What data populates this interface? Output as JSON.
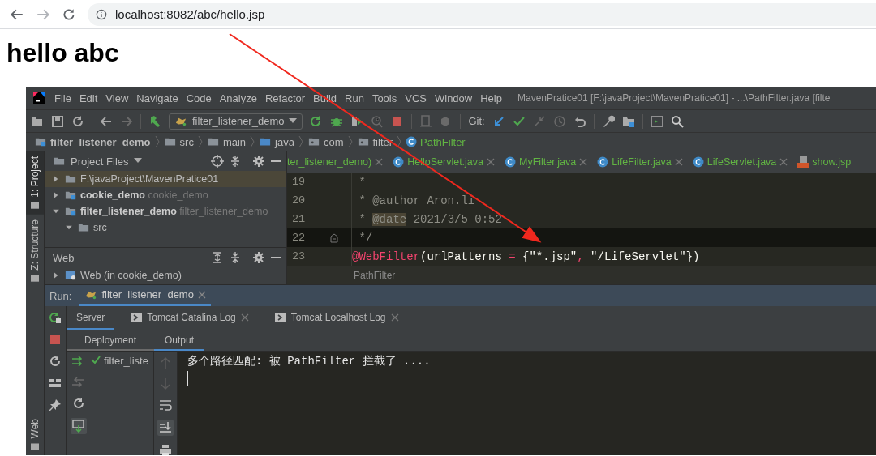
{
  "browser": {
    "address": "localhost:8082/abc/hello.jsp"
  },
  "page": {
    "heading": "hello abc"
  },
  "ide": {
    "menu": [
      "File",
      "Edit",
      "View",
      "Navigate",
      "Code",
      "Analyze",
      "Refactor",
      "Build",
      "Run",
      "Tools",
      "VCS",
      "Window",
      "Help"
    ],
    "title": "MavenPratice01 [F:\\javaProject\\MavenPratice01] - ...\\PathFilter.java [filte",
    "run_config": "filter_listener_demo",
    "git_label": "Git:",
    "breadcrumb": [
      {
        "label": "filter_listener_demo",
        "kind": "module"
      },
      {
        "label": "src",
        "kind": "folder"
      },
      {
        "label": "main",
        "kind": "folder"
      },
      {
        "label": "java",
        "kind": "source"
      },
      {
        "label": "com",
        "kind": "package"
      },
      {
        "label": "filter",
        "kind": "package"
      },
      {
        "label": "PathFilter",
        "kind": "class"
      }
    ],
    "left_stripe": [
      {
        "label": "1: Project",
        "selected": true
      },
      {
        "label": "Z: Structure",
        "selected": false
      }
    ],
    "bottom_stripe": [
      {
        "label": "Web",
        "selected": false
      }
    ],
    "project": {
      "title": "Project Files",
      "tree": [
        {
          "label": "F:\\javaProject\\MavenPratice01",
          "kind": "folder",
          "expanded": false,
          "selected": true
        },
        {
          "label": "cookie_demo",
          "hint": "cookie_demo",
          "kind": "module",
          "expanded": false,
          "selected": false
        },
        {
          "label": "filter_listener_demo",
          "hint": "filter_listener_demo",
          "kind": "module",
          "expanded": true,
          "selected": false,
          "children": [
            {
              "label": "src",
              "kind": "folder",
              "expanded": true,
              "selected": false
            }
          ]
        }
      ]
    },
    "web": {
      "title": "Web",
      "tree": [
        {
          "label": "Web (in cookie_demo)",
          "kind": "web",
          "expanded": false,
          "selected": false
        }
      ]
    },
    "editor_tabs": [
      {
        "label": "ter_listener_demo)",
        "kind": "none"
      },
      {
        "label": "HelloServlet.java",
        "kind": "class"
      },
      {
        "label": "MyFilter.java",
        "kind": "class"
      },
      {
        "label": "LifeFilter.java",
        "kind": "class"
      },
      {
        "label": "LifeServlet.java",
        "kind": "class"
      },
      {
        "label": "show.jsp",
        "kind": "jsp"
      }
    ],
    "code": [
      {
        "number": "19",
        "current": false,
        "tokens": [
          {
            "kind": "comment",
            "text": " *"
          }
        ]
      },
      {
        "number": "20",
        "current": false,
        "tokens": [
          {
            "kind": "comment",
            "text": " * @author Aron.li"
          }
        ]
      },
      {
        "number": "21",
        "current": false,
        "tokens": [
          {
            "kind": "comment",
            "text": " * "
          },
          {
            "kind": "doc_tag",
            "text": "@date"
          },
          {
            "kind": "comment",
            "text": " 2021/3/5 0:52"
          }
        ]
      },
      {
        "number": "22",
        "current": true,
        "tokens": [
          {
            "kind": "comment",
            "text": " */"
          }
        ]
      },
      {
        "number": "23",
        "current": false,
        "tokens": [
          {
            "kind": "annotation",
            "text": "@WebFilter"
          },
          {
            "kind": "plain",
            "text": "(urlPatterns "
          },
          {
            "kind": "operator",
            "text": "="
          },
          {
            "kind": "plain",
            "text": " {"
          },
          {
            "kind": "string",
            "text": "\"*.jsp\""
          },
          {
            "kind": "operator",
            "text": ", "
          },
          {
            "kind": "string",
            "text": "\"/LifeServlet\""
          },
          {
            "kind": "plain",
            "text": "})"
          }
        ]
      }
    ],
    "code_breadcrumb": "PathFilter",
    "run": {
      "label": "Run:",
      "tab": "filter_listener_demo",
      "server_tabs": [
        {
          "label": "Server",
          "kind": "plain",
          "selected": true
        },
        {
          "label": "Tomcat Catalina Log",
          "kind": "log",
          "selected": false
        },
        {
          "label": "Tomcat Localhost Log",
          "kind": "log",
          "selected": false
        }
      ],
      "sub_tabs": [
        {
          "label": "Deployment",
          "selected": false
        },
        {
          "label": "Output",
          "selected": true
        }
      ],
      "deployments": [
        {
          "label": "filter_liste"
        }
      ],
      "output": [
        "多个路径匹配: 被 PathFilter 拦截了 ...."
      ]
    }
  }
}
